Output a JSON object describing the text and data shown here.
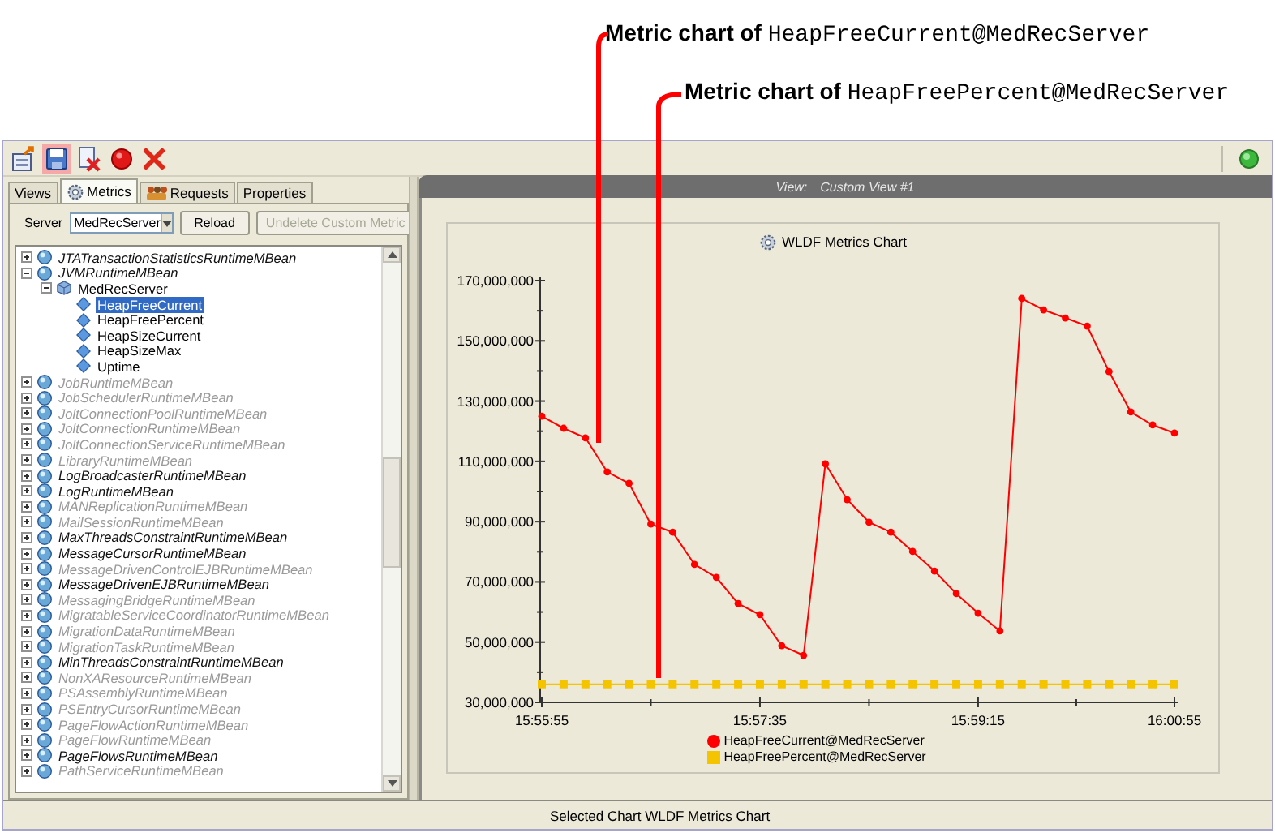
{
  "callouts": [
    {
      "label": "Metric chart of ",
      "metric": "HeapFreeCurrent@MedRecServer"
    },
    {
      "label": "Metric chart of ",
      "metric": "HeapFreePercent@MedRecServer"
    }
  ],
  "toolbar": {
    "buttons": [
      {
        "kind": "export",
        "selected": false
      },
      {
        "kind": "save",
        "selected": true
      },
      {
        "kind": "delete",
        "selected": false
      },
      {
        "kind": "record",
        "selected": false
      },
      {
        "kind": "stop",
        "selected": false
      }
    ]
  },
  "tabs": [
    {
      "label": "Views",
      "kind": "plain",
      "selected": false
    },
    {
      "label": "Metrics",
      "kind": "gear",
      "selected": true
    },
    {
      "label": "Requests",
      "kind": "people",
      "selected": false
    },
    {
      "label": "Properties",
      "kind": "plain",
      "selected": false
    }
  ],
  "server": {
    "label": "Server",
    "value": "MedRecServer"
  },
  "buttons": [
    {
      "label": "Reload",
      "disabled": false
    },
    {
      "label": "Undelete Custom Metric",
      "disabled": true
    }
  ],
  "tree": [
    {
      "label": "JTATransactionStatisticsRuntimeMBean",
      "disabled": false,
      "expanded": false
    },
    {
      "label": "JVMRuntimeMBean",
      "disabled": false,
      "expanded": true,
      "children": [
        {
          "label": "MedRecServer",
          "expanded": true,
          "children": [
            {
              "label": "HeapFreeCurrent",
              "selected": true
            },
            {
              "label": "HeapFreePercent",
              "selected": false
            },
            {
              "label": "HeapSizeCurrent",
              "selected": false
            },
            {
              "label": "HeapSizeMax",
              "selected": false
            },
            {
              "label": "Uptime",
              "selected": false
            }
          ]
        }
      ]
    },
    {
      "label": "JobRuntimeMBean",
      "disabled": true,
      "expanded": false
    },
    {
      "label": "JobSchedulerRuntimeMBean",
      "disabled": true,
      "expanded": false
    },
    {
      "label": "JoltConnectionPoolRuntimeMBean",
      "disabled": true,
      "expanded": false
    },
    {
      "label": "JoltConnectionRuntimeMBean",
      "disabled": true,
      "expanded": false
    },
    {
      "label": "JoltConnectionServiceRuntimeMBean",
      "disabled": true,
      "expanded": false
    },
    {
      "label": "LibraryRuntimeMBean",
      "disabled": true,
      "expanded": false
    },
    {
      "label": "LogBroadcasterRuntimeMBean",
      "disabled": false,
      "expanded": false
    },
    {
      "label": "LogRuntimeMBean",
      "disabled": false,
      "expanded": false
    },
    {
      "label": "MANReplicationRuntimeMBean",
      "disabled": true,
      "expanded": false
    },
    {
      "label": "MailSessionRuntimeMBean",
      "disabled": true,
      "expanded": false
    },
    {
      "label": "MaxThreadsConstraintRuntimeMBean",
      "disabled": false,
      "expanded": false
    },
    {
      "label": "MessageCursorRuntimeMBean",
      "disabled": false,
      "expanded": false
    },
    {
      "label": "MessageDrivenControlEJBRuntimeMBean",
      "disabled": true,
      "expanded": false
    },
    {
      "label": "MessageDrivenEJBRuntimeMBean",
      "disabled": false,
      "expanded": false
    },
    {
      "label": "MessagingBridgeRuntimeMBean",
      "disabled": true,
      "expanded": false
    },
    {
      "label": "MigratableServiceCoordinatorRuntimeMBean",
      "disabled": true,
      "expanded": false
    },
    {
      "label": "MigrationDataRuntimeMBean",
      "disabled": true,
      "expanded": false
    },
    {
      "label": "MigrationTaskRuntimeMBean",
      "disabled": true,
      "expanded": false
    },
    {
      "label": "MinThreadsConstraintRuntimeMBean",
      "disabled": false,
      "expanded": false
    },
    {
      "label": "NonXAResourceRuntimeMBean",
      "disabled": true,
      "expanded": false
    },
    {
      "label": "PSAssemblyRuntimeMBean",
      "disabled": true,
      "expanded": false
    },
    {
      "label": "PSEntryCursorRuntimeMBean",
      "disabled": true,
      "expanded": false
    },
    {
      "label": "PageFlowActionRuntimeMBean",
      "disabled": true,
      "expanded": false
    },
    {
      "label": "PageFlowRuntimeMBean",
      "disabled": true,
      "expanded": false
    },
    {
      "label": "PageFlowsRuntimeMBean",
      "disabled": false,
      "expanded": false
    },
    {
      "label": "PathServiceRuntimeMBean",
      "disabled": true,
      "expanded": false
    }
  ],
  "view_bar": {
    "label": "View:",
    "value": "Custom View #1"
  },
  "chart": {
    "title": "WLDF Metrics Chart",
    "chart_data": {
      "type": "line",
      "categories": [
        "15:55:55",
        null,
        null,
        null,
        null,
        null,
        null,
        null,
        null,
        null,
        "15:57:35",
        null,
        null,
        null,
        null,
        null,
        null,
        null,
        null,
        null,
        "15:59:15",
        null,
        null,
        null,
        null,
        null,
        null,
        null,
        null,
        "16:00:55"
      ],
      "series": [
        {
          "name": "HeapFreeCurrent@MedRecServer",
          "color": "#ff0000",
          "marker": "circle",
          "values": [
            125000000,
            121000000,
            117800000,
            106500000,
            102700000,
            89200000,
            86500000,
            75800000,
            71500000,
            62800000,
            59100000,
            48800000,
            45600000,
            109200000,
            97300000,
            89800000,
            86500000,
            80100000,
            73600000,
            66100000,
            59600000,
            53700000,
            164100000,
            160300000,
            157600000,
            154900000,
            139800000,
            126400000,
            122100000,
            119400000
          ]
        },
        {
          "name": "HeapFreePercent@MedRecServer",
          "color": "#f5c400",
          "marker": "square",
          "values": [
            36000000,
            36000000,
            36000000,
            36000000,
            36000000,
            36000000,
            36000000,
            36000000,
            36000000,
            36000000,
            36000000,
            36000000,
            36000000,
            36000000,
            36000000,
            36000000,
            36000000,
            36000000,
            36000000,
            36000000,
            36000000,
            36000000,
            36000000,
            36000000,
            36000000,
            36000000,
            36000000,
            36000000,
            36000000,
            36000000
          ]
        }
      ],
      "ylim": [
        30000000,
        170000000
      ],
      "yticks": [
        {
          "value": 30000000,
          "label": "30,000,000"
        },
        {
          "value": 50000000,
          "label": "50,000,000"
        },
        {
          "value": 70000000,
          "label": "70,000,000"
        },
        {
          "value": 90000000,
          "label": "90,000,000"
        },
        {
          "value": 110000000,
          "label": "110,000,000"
        },
        {
          "value": 130000000,
          "label": "130,000,000"
        },
        {
          "value": 150000000,
          "label": "150,000,000"
        },
        {
          "value": 170000000,
          "label": "170,000,000"
        }
      ]
    }
  },
  "status_bar": {
    "text": "Selected Chart WLDF Metrics Chart"
  }
}
